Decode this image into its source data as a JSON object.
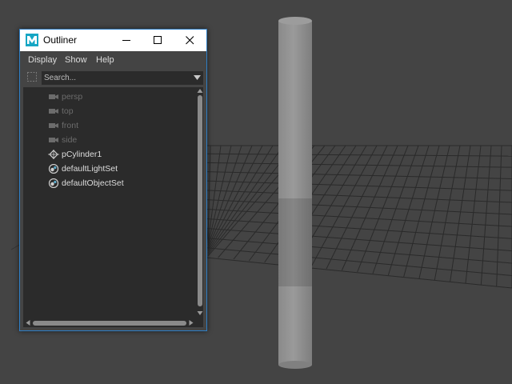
{
  "window": {
    "title": "Outliner",
    "app_icon": "maya-logo-icon",
    "controls": [
      "minimize-icon",
      "maximize-icon",
      "close-icon"
    ]
  },
  "menubar": {
    "items": [
      "Display",
      "Show",
      "Help"
    ]
  },
  "search": {
    "placeholder": "Search..."
  },
  "outliner": {
    "items": [
      {
        "label": "persp",
        "icon": "camera-icon",
        "dimmed": true
      },
      {
        "label": "top",
        "icon": "camera-icon",
        "dimmed": true
      },
      {
        "label": "front",
        "icon": "camera-icon",
        "dimmed": true
      },
      {
        "label": "side",
        "icon": "camera-icon",
        "dimmed": true
      },
      {
        "label": "pCylinder1",
        "icon": "transform-icon",
        "dimmed": false
      },
      {
        "label": "defaultLightSet",
        "icon": "set-icon",
        "dimmed": false
      },
      {
        "label": "defaultObjectSet",
        "icon": "set-icon",
        "dimmed": false
      }
    ]
  },
  "viewport": {
    "background": "#444444",
    "objects": [
      "cylinder",
      "grid"
    ]
  },
  "colors": {
    "window_border": "#2f7fc6",
    "titlebar": "#ffffff",
    "tree_bg": "#2b2b2b",
    "dim_text": "#6c6c6c",
    "text": "#dddddd"
  }
}
